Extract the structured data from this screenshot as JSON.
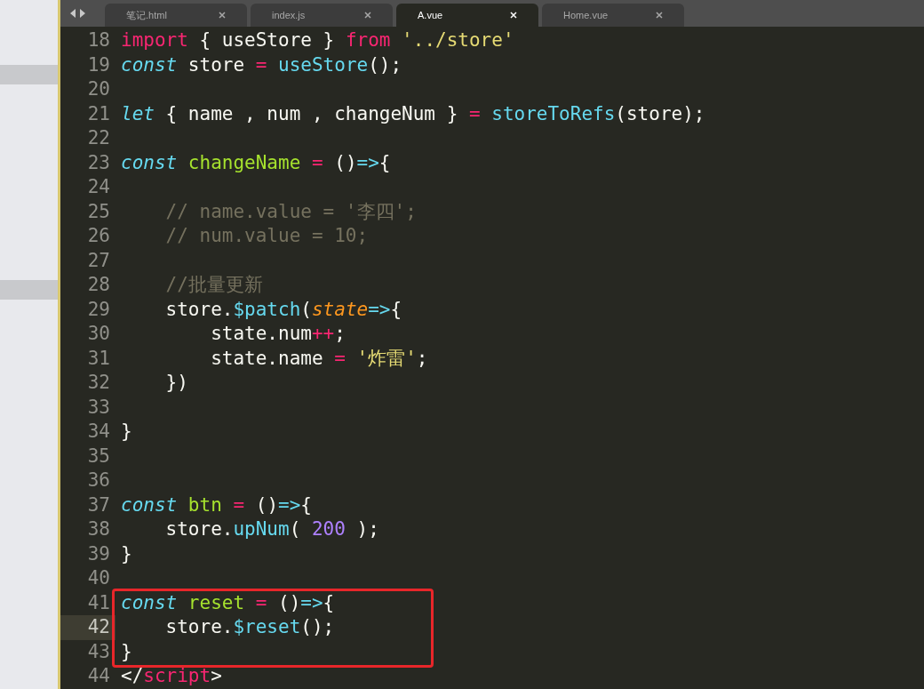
{
  "tabs": [
    {
      "label": "笔记.html",
      "selected": false
    },
    {
      "label": "index.js",
      "selected": false
    },
    {
      "label": "A.vue",
      "selected": true
    },
    {
      "label": "Home.vue",
      "selected": false
    }
  ],
  "lines": [
    {
      "number": "18",
      "current": false,
      "boxed": false,
      "tokens": [
        {
          "kind": "keyword",
          "text": "import"
        },
        {
          "kind": "plain",
          "text": " { useStore } "
        },
        {
          "kind": "keyword",
          "text": "from "
        },
        {
          "kind": "string",
          "text": "'../store'"
        }
      ]
    },
    {
      "number": "19",
      "current": false,
      "boxed": false,
      "tokens": [
        {
          "kind": "storage",
          "text": "const"
        },
        {
          "kind": "plain",
          "text": " store "
        },
        {
          "kind": "keyword",
          "text": "= "
        },
        {
          "kind": "support",
          "text": "useStore"
        },
        {
          "kind": "plain",
          "text": "();"
        }
      ]
    },
    {
      "number": "20",
      "current": false,
      "boxed": false
    },
    {
      "number": "21",
      "current": false,
      "boxed": false,
      "tokens": [
        {
          "kind": "storage",
          "text": "let"
        },
        {
          "kind": "plain",
          "text": " { name , num , changeNum } "
        },
        {
          "kind": "keyword",
          "text": "= "
        },
        {
          "kind": "support",
          "text": "storeToRefs"
        },
        {
          "kind": "plain",
          "text": "(store);"
        }
      ]
    },
    {
      "number": "22",
      "current": false,
      "boxed": false
    },
    {
      "number": "23",
      "current": false,
      "boxed": false,
      "tokens": [
        {
          "kind": "storage",
          "text": "const "
        },
        {
          "kind": "entity",
          "text": "changeName "
        },
        {
          "kind": "keyword",
          "text": "="
        },
        {
          "kind": "plain",
          "text": " ()"
        },
        {
          "kind": "support",
          "text": "=>"
        },
        {
          "kind": "plain",
          "text": "{"
        }
      ]
    },
    {
      "number": "24",
      "current": false,
      "boxed": false
    },
    {
      "number": "25",
      "current": false,
      "boxed": false,
      "tokens": [
        {
          "kind": "comment",
          "text": "    // name.value = '李四';"
        }
      ]
    },
    {
      "number": "26",
      "current": false,
      "boxed": false,
      "tokens": [
        {
          "kind": "comment",
          "text": "    // num.value = 10;"
        }
      ]
    },
    {
      "number": "27",
      "current": false,
      "boxed": false
    },
    {
      "number": "28",
      "current": false,
      "boxed": false,
      "tokens": [
        {
          "kind": "comment",
          "text": "    //批量更新"
        }
      ]
    },
    {
      "number": "29",
      "current": false,
      "boxed": false,
      "tokens": [
        {
          "kind": "plain",
          "text": "    store."
        },
        {
          "kind": "support",
          "text": "$patch"
        },
        {
          "kind": "plain",
          "text": "("
        },
        {
          "kind": "param",
          "text": "state"
        },
        {
          "kind": "support",
          "text": "=>"
        },
        {
          "kind": "plain",
          "text": "{"
        }
      ]
    },
    {
      "number": "30",
      "current": false,
      "boxed": false,
      "tokens": [
        {
          "kind": "plain",
          "text": "        state.num"
        },
        {
          "kind": "keyword",
          "text": "++"
        },
        {
          "kind": "plain",
          "text": ";"
        }
      ]
    },
    {
      "number": "31",
      "current": false,
      "boxed": false,
      "tokens": [
        {
          "kind": "plain",
          "text": "        state.name "
        },
        {
          "kind": "keyword",
          "text": "= "
        },
        {
          "kind": "string",
          "text": "'炸雷'"
        },
        {
          "kind": "plain",
          "text": ";"
        }
      ]
    },
    {
      "number": "32",
      "current": false,
      "boxed": false,
      "tokens": [
        {
          "kind": "plain",
          "text": "    })"
        }
      ]
    },
    {
      "number": "33",
      "current": false,
      "boxed": false
    },
    {
      "number": "34",
      "current": false,
      "boxed": false,
      "tokens": [
        {
          "kind": "plain",
          "text": "}"
        }
      ]
    },
    {
      "number": "35",
      "current": false,
      "boxed": false
    },
    {
      "number": "36",
      "current": false,
      "boxed": false
    },
    {
      "number": "37",
      "current": false,
      "boxed": false,
      "tokens": [
        {
          "kind": "storage",
          "text": "const "
        },
        {
          "kind": "entity",
          "text": "btn "
        },
        {
          "kind": "keyword",
          "text": "="
        },
        {
          "kind": "plain",
          "text": " ()"
        },
        {
          "kind": "support",
          "text": "=>"
        },
        {
          "kind": "plain",
          "text": "{"
        }
      ]
    },
    {
      "number": "38",
      "current": false,
      "boxed": false,
      "tokens": [
        {
          "kind": "plain",
          "text": "    store."
        },
        {
          "kind": "support",
          "text": "upNum"
        },
        {
          "kind": "plain",
          "text": "( "
        },
        {
          "kind": "number",
          "text": "200"
        },
        {
          "kind": "plain",
          "text": " );"
        }
      ]
    },
    {
      "number": "39",
      "current": false,
      "boxed": false,
      "tokens": [
        {
          "kind": "plain",
          "text": "}"
        }
      ]
    },
    {
      "number": "40",
      "current": false,
      "boxed": false
    },
    {
      "number": "41",
      "current": false,
      "boxed": true,
      "tokens": [
        {
          "kind": "storage",
          "text": "const "
        },
        {
          "kind": "entity",
          "text": "reset "
        },
        {
          "kind": "keyword",
          "text": "="
        },
        {
          "kind": "plain",
          "text": " ()"
        },
        {
          "kind": "support",
          "text": "=>"
        },
        {
          "kind": "plain",
          "text": "{"
        }
      ]
    },
    {
      "number": "42",
      "current": true,
      "boxed": true,
      "tokens": [
        {
          "kind": "plain",
          "text": "    store."
        },
        {
          "kind": "support",
          "text": "$reset"
        },
        {
          "kind": "plain",
          "text": "();"
        }
      ]
    },
    {
      "number": "43",
      "current": false,
      "boxed": true,
      "tokens": [
        {
          "kind": "plain",
          "text": "}"
        }
      ]
    },
    {
      "number": "44",
      "current": false,
      "boxed": false,
      "tokens": [
        {
          "kind": "plain",
          "text": "</"
        },
        {
          "kind": "keyword",
          "text": "script"
        },
        {
          "kind": "plain",
          "text": ">"
        }
      ]
    }
  ]
}
